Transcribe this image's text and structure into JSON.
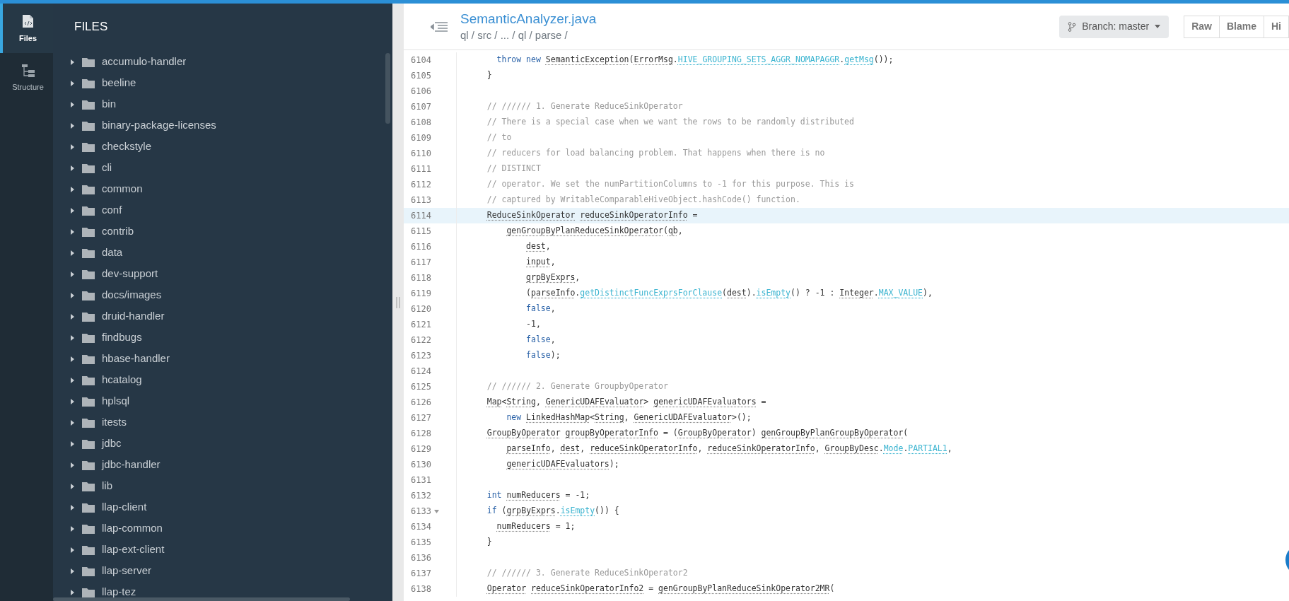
{
  "rail": {
    "tabs": [
      {
        "label": "Files",
        "kind": "files",
        "selected": true
      },
      {
        "label": "Structure",
        "kind": "structure",
        "selected": false
      }
    ]
  },
  "files": {
    "title": "FILES",
    "items": [
      {
        "name": "accumulo-handler",
        "expanded": false
      },
      {
        "name": "beeline",
        "expanded": false
      },
      {
        "name": "bin",
        "expanded": false
      },
      {
        "name": "binary-package-licenses",
        "expanded": false
      },
      {
        "name": "checkstyle",
        "expanded": false
      },
      {
        "name": "cli",
        "expanded": false
      },
      {
        "name": "common",
        "expanded": false
      },
      {
        "name": "conf",
        "expanded": false
      },
      {
        "name": "contrib",
        "expanded": false
      },
      {
        "name": "data",
        "expanded": false
      },
      {
        "name": "dev-support",
        "expanded": false
      },
      {
        "name": "docs/images",
        "expanded": false
      },
      {
        "name": "druid-handler",
        "expanded": false
      },
      {
        "name": "findbugs",
        "expanded": false
      },
      {
        "name": "hbase-handler",
        "expanded": false
      },
      {
        "name": "hcatalog",
        "expanded": false
      },
      {
        "name": "hplsql",
        "expanded": false
      },
      {
        "name": "itests",
        "expanded": false
      },
      {
        "name": "jdbc",
        "expanded": false
      },
      {
        "name": "jdbc-handler",
        "expanded": false
      },
      {
        "name": "lib",
        "expanded": false
      },
      {
        "name": "llap-client",
        "expanded": false
      },
      {
        "name": "llap-common",
        "expanded": false
      },
      {
        "name": "llap-ext-client",
        "expanded": false
      },
      {
        "name": "llap-server",
        "expanded": false
      },
      {
        "name": "llap-tez",
        "expanded": false
      }
    ]
  },
  "header": {
    "title": "SemanticAnalyzer.java",
    "breadcrumb": "ql / src / ... / ql / parse /",
    "branch": "Branch: master",
    "buttons": [
      "Raw",
      "Blame",
      "Hi"
    ]
  },
  "code": {
    "lines": [
      {
        "number": "6104",
        "kind": "plain",
        "selected": false,
        "parts": [
          {
            "kind": "keyword",
            "text": "      throw "
          },
          {
            "kind": "keyword",
            "text": "new "
          },
          {
            "kind": "name",
            "text": "SemanticException"
          },
          {
            "kind": "plain",
            "text": "("
          },
          {
            "kind": "name",
            "text": "ErrorMsg"
          },
          {
            "kind": "plain",
            "text": "."
          },
          {
            "kind": "member",
            "text": "HIVE_GROUPING_SETS_AGGR_NOMAPAGGR"
          },
          {
            "kind": "plain",
            "text": "."
          },
          {
            "kind": "member",
            "text": "getMsg"
          },
          {
            "kind": "plain",
            "text": "());"
          }
        ]
      },
      {
        "number": "6105",
        "kind": "plain",
        "selected": false,
        "parts": [
          {
            "kind": "plain",
            "text": "    }"
          }
        ]
      },
      {
        "number": "6106",
        "kind": "plain",
        "selected": false
      },
      {
        "number": "6107",
        "kind": "plain",
        "selected": false,
        "parts": [
          {
            "kind": "comment",
            "text": "    // ////// 1. Generate ReduceSinkOperator"
          }
        ]
      },
      {
        "number": "6108",
        "kind": "plain",
        "selected": false,
        "parts": [
          {
            "kind": "comment",
            "text": "    // There is a special case when we want the rows to be randomly distributed"
          }
        ]
      },
      {
        "number": "6109",
        "kind": "plain",
        "selected": false,
        "parts": [
          {
            "kind": "comment",
            "text": "    // to"
          }
        ]
      },
      {
        "number": "6110",
        "kind": "plain",
        "selected": false,
        "parts": [
          {
            "kind": "comment",
            "text": "    // reducers for load balancing problem. That happens when there is no"
          }
        ]
      },
      {
        "number": "6111",
        "kind": "plain",
        "selected": false,
        "parts": [
          {
            "kind": "comment",
            "text": "    // DISTINCT"
          }
        ]
      },
      {
        "number": "6112",
        "kind": "plain",
        "selected": false,
        "parts": [
          {
            "kind": "comment",
            "text": "    // operator. We set the numPartitionColumns to -1 for this purpose. This is"
          }
        ]
      },
      {
        "number": "6113",
        "kind": "plain",
        "selected": false,
        "parts": [
          {
            "kind": "comment",
            "text": "    // captured by WritableComparableHiveObject.hashCode() function."
          }
        ]
      },
      {
        "number": "6114",
        "kind": "plain",
        "selected": true,
        "parts": [
          {
            "kind": "name",
            "text": "    ReduceSinkOperator "
          },
          {
            "kind": "name",
            "text": "reduceSinkOperatorInfo"
          },
          {
            "kind": "plain",
            "text": " ="
          }
        ]
      },
      {
        "number": "6115",
        "kind": "plain",
        "selected": false,
        "parts": [
          {
            "kind": "name",
            "text": "        genGroupByPlanReduceSinkOperator"
          },
          {
            "kind": "plain",
            "text": "("
          },
          {
            "kind": "name",
            "text": "qb"
          },
          {
            "kind": "plain",
            "text": ","
          }
        ]
      },
      {
        "number": "6116",
        "kind": "plain",
        "selected": false,
        "parts": [
          {
            "kind": "name",
            "text": "            dest"
          },
          {
            "kind": "plain",
            "text": ","
          }
        ]
      },
      {
        "number": "6117",
        "kind": "plain",
        "selected": false,
        "parts": [
          {
            "kind": "name",
            "text": "            input"
          },
          {
            "kind": "plain",
            "text": ","
          }
        ]
      },
      {
        "number": "6118",
        "kind": "plain",
        "selected": false,
        "parts": [
          {
            "kind": "name",
            "text": "            grpByExprs"
          },
          {
            "kind": "plain",
            "text": ","
          }
        ]
      },
      {
        "number": "6119",
        "kind": "plain",
        "selected": false,
        "parts": [
          {
            "kind": "plain",
            "text": "            ("
          },
          {
            "kind": "name",
            "text": "parseInfo"
          },
          {
            "kind": "plain",
            "text": "."
          },
          {
            "kind": "member",
            "text": "getDistinctFuncExprsForClause"
          },
          {
            "kind": "plain",
            "text": "("
          },
          {
            "kind": "name",
            "text": "dest"
          },
          {
            "kind": "plain",
            "text": ")."
          },
          {
            "kind": "member",
            "text": "isEmpty"
          },
          {
            "kind": "plain",
            "text": "() ? -1 : "
          },
          {
            "kind": "name",
            "text": "Integer"
          },
          {
            "kind": "plain",
            "text": "."
          },
          {
            "kind": "member",
            "text": "MAX_VALUE"
          },
          {
            "kind": "plain",
            "text": "),"
          }
        ]
      },
      {
        "number": "6120",
        "kind": "plain",
        "selected": false,
        "parts": [
          {
            "kind": "keyword",
            "text": "            false"
          },
          {
            "kind": "plain",
            "text": ","
          }
        ]
      },
      {
        "number": "6121",
        "kind": "plain",
        "selected": false,
        "parts": [
          {
            "kind": "plain",
            "text": "            -1,"
          }
        ]
      },
      {
        "number": "6122",
        "kind": "plain",
        "selected": false,
        "parts": [
          {
            "kind": "keyword",
            "text": "            false"
          },
          {
            "kind": "plain",
            "text": ","
          }
        ]
      },
      {
        "number": "6123",
        "kind": "plain",
        "selected": false,
        "parts": [
          {
            "kind": "keyword",
            "text": "            false"
          },
          {
            "kind": "plain",
            "text": ");"
          }
        ]
      },
      {
        "number": "6124",
        "kind": "plain",
        "selected": false
      },
      {
        "number": "6125",
        "kind": "plain",
        "selected": false,
        "parts": [
          {
            "kind": "comment",
            "text": "    // ////// 2. Generate GroupbyOperator"
          }
        ]
      },
      {
        "number": "6126",
        "kind": "plain",
        "selected": false,
        "parts": [
          {
            "kind": "name",
            "text": "    Map"
          },
          {
            "kind": "plain",
            "text": "<"
          },
          {
            "kind": "name",
            "text": "String"
          },
          {
            "kind": "plain",
            "text": ", "
          },
          {
            "kind": "name",
            "text": "GenericUDAFEvaluator"
          },
          {
            "kind": "plain",
            "text": "> "
          },
          {
            "kind": "name",
            "text": "genericUDAFEvaluators"
          },
          {
            "kind": "plain",
            "text": " ="
          }
        ]
      },
      {
        "number": "6127",
        "kind": "plain",
        "selected": false,
        "parts": [
          {
            "kind": "keyword",
            "text": "        new "
          },
          {
            "kind": "name",
            "text": "LinkedHashMap"
          },
          {
            "kind": "plain",
            "text": "<"
          },
          {
            "kind": "name",
            "text": "String"
          },
          {
            "kind": "plain",
            "text": ", "
          },
          {
            "kind": "name",
            "text": "GenericUDAFEvaluator"
          },
          {
            "kind": "plain",
            "text": ">();"
          }
        ]
      },
      {
        "number": "6128",
        "kind": "plain",
        "selected": false,
        "parts": [
          {
            "kind": "name",
            "text": "    GroupByOperator "
          },
          {
            "kind": "name",
            "text": "groupByOperatorInfo"
          },
          {
            "kind": "plain",
            "text": " = ("
          },
          {
            "kind": "name",
            "text": "GroupByOperator"
          },
          {
            "kind": "plain",
            "text": ") "
          },
          {
            "kind": "name",
            "text": "genGroupByPlanGroupByOperator"
          },
          {
            "kind": "plain",
            "text": "("
          }
        ]
      },
      {
        "number": "6129",
        "kind": "plain",
        "selected": false,
        "parts": [
          {
            "kind": "name",
            "text": "        parseInfo"
          },
          {
            "kind": "plain",
            "text": ", "
          },
          {
            "kind": "name",
            "text": "dest"
          },
          {
            "kind": "plain",
            "text": ", "
          },
          {
            "kind": "name",
            "text": "reduceSinkOperatorInfo"
          },
          {
            "kind": "plain",
            "text": ", "
          },
          {
            "kind": "name",
            "text": "reduceSinkOperatorInfo"
          },
          {
            "kind": "plain",
            "text": ", "
          },
          {
            "kind": "name",
            "text": "GroupByDesc"
          },
          {
            "kind": "plain",
            "text": "."
          },
          {
            "kind": "member",
            "text": "Mode"
          },
          {
            "kind": "plain",
            "text": "."
          },
          {
            "kind": "member",
            "text": "PARTIAL1"
          },
          {
            "kind": "plain",
            "text": ","
          }
        ]
      },
      {
        "number": "6130",
        "kind": "plain",
        "selected": false,
        "parts": [
          {
            "kind": "name",
            "text": "        genericUDAFEvaluators"
          },
          {
            "kind": "plain",
            "text": ");"
          }
        ]
      },
      {
        "number": "6131",
        "kind": "plain",
        "selected": false
      },
      {
        "number": "6132",
        "kind": "plain",
        "selected": false,
        "parts": [
          {
            "kind": "keyword",
            "text": "    int "
          },
          {
            "kind": "name",
            "text": "numReducers"
          },
          {
            "kind": "plain",
            "text": " = -1;"
          }
        ]
      },
      {
        "number": "6133",
        "kind": "fold",
        "selected": false,
        "parts": [
          {
            "kind": "keyword",
            "text": "    if"
          },
          {
            "kind": "plain",
            "text": " ("
          },
          {
            "kind": "name",
            "text": "grpByExprs"
          },
          {
            "kind": "plain",
            "text": "."
          },
          {
            "kind": "member",
            "text": "isEmpty"
          },
          {
            "kind": "plain",
            "text": "()) {"
          }
        ]
      },
      {
        "number": "6134",
        "kind": "plain",
        "selected": false,
        "parts": [
          {
            "kind": "name",
            "text": "      numReducers"
          },
          {
            "kind": "plain",
            "text": " = 1;"
          }
        ]
      },
      {
        "number": "6135",
        "kind": "plain",
        "selected": false,
        "parts": [
          {
            "kind": "plain",
            "text": "    }"
          }
        ]
      },
      {
        "number": "6136",
        "kind": "plain",
        "selected": false
      },
      {
        "number": "6137",
        "kind": "plain",
        "selected": false,
        "parts": [
          {
            "kind": "comment",
            "text": "    // ////// 3. Generate ReduceSinkOperator2"
          }
        ]
      },
      {
        "number": "6138",
        "kind": "plain",
        "selected": false,
        "parts": [
          {
            "kind": "name",
            "text": "    Operator "
          },
          {
            "kind": "name",
            "text": "reduceSinkOperatorInfo2"
          },
          {
            "kind": "plain",
            "text": " = "
          },
          {
            "kind": "name",
            "text": "genGroupByPlanReduceSinkOperator2MR"
          },
          {
            "kind": "plain",
            "text": "("
          }
        ]
      }
    ]
  }
}
